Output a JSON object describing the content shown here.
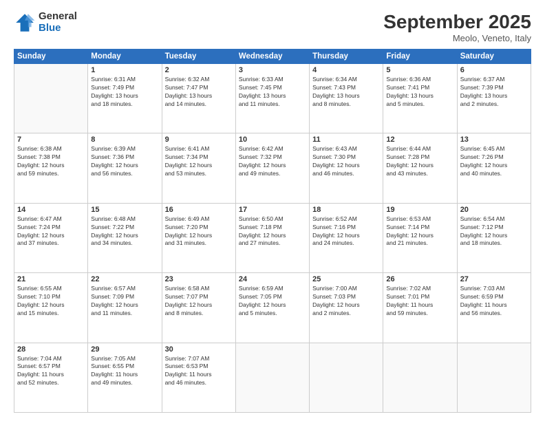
{
  "logo": {
    "general": "General",
    "blue": "Blue"
  },
  "header": {
    "month": "September 2025",
    "location": "Meolo, Veneto, Italy"
  },
  "weekdays": [
    "Sunday",
    "Monday",
    "Tuesday",
    "Wednesday",
    "Thursday",
    "Friday",
    "Saturday"
  ],
  "weeks": [
    [
      {
        "day": "",
        "info": ""
      },
      {
        "day": "1",
        "info": "Sunrise: 6:31 AM\nSunset: 7:49 PM\nDaylight: 13 hours\nand 18 minutes."
      },
      {
        "day": "2",
        "info": "Sunrise: 6:32 AM\nSunset: 7:47 PM\nDaylight: 13 hours\nand 14 minutes."
      },
      {
        "day": "3",
        "info": "Sunrise: 6:33 AM\nSunset: 7:45 PM\nDaylight: 13 hours\nand 11 minutes."
      },
      {
        "day": "4",
        "info": "Sunrise: 6:34 AM\nSunset: 7:43 PM\nDaylight: 13 hours\nand 8 minutes."
      },
      {
        "day": "5",
        "info": "Sunrise: 6:36 AM\nSunset: 7:41 PM\nDaylight: 13 hours\nand 5 minutes."
      },
      {
        "day": "6",
        "info": "Sunrise: 6:37 AM\nSunset: 7:39 PM\nDaylight: 13 hours\nand 2 minutes."
      }
    ],
    [
      {
        "day": "7",
        "info": "Sunrise: 6:38 AM\nSunset: 7:38 PM\nDaylight: 12 hours\nand 59 minutes."
      },
      {
        "day": "8",
        "info": "Sunrise: 6:39 AM\nSunset: 7:36 PM\nDaylight: 12 hours\nand 56 minutes."
      },
      {
        "day": "9",
        "info": "Sunrise: 6:41 AM\nSunset: 7:34 PM\nDaylight: 12 hours\nand 53 minutes."
      },
      {
        "day": "10",
        "info": "Sunrise: 6:42 AM\nSunset: 7:32 PM\nDaylight: 12 hours\nand 49 minutes."
      },
      {
        "day": "11",
        "info": "Sunrise: 6:43 AM\nSunset: 7:30 PM\nDaylight: 12 hours\nand 46 minutes."
      },
      {
        "day": "12",
        "info": "Sunrise: 6:44 AM\nSunset: 7:28 PM\nDaylight: 12 hours\nand 43 minutes."
      },
      {
        "day": "13",
        "info": "Sunrise: 6:45 AM\nSunset: 7:26 PM\nDaylight: 12 hours\nand 40 minutes."
      }
    ],
    [
      {
        "day": "14",
        "info": "Sunrise: 6:47 AM\nSunset: 7:24 PM\nDaylight: 12 hours\nand 37 minutes."
      },
      {
        "day": "15",
        "info": "Sunrise: 6:48 AM\nSunset: 7:22 PM\nDaylight: 12 hours\nand 34 minutes."
      },
      {
        "day": "16",
        "info": "Sunrise: 6:49 AM\nSunset: 7:20 PM\nDaylight: 12 hours\nand 31 minutes."
      },
      {
        "day": "17",
        "info": "Sunrise: 6:50 AM\nSunset: 7:18 PM\nDaylight: 12 hours\nand 27 minutes."
      },
      {
        "day": "18",
        "info": "Sunrise: 6:52 AM\nSunset: 7:16 PM\nDaylight: 12 hours\nand 24 minutes."
      },
      {
        "day": "19",
        "info": "Sunrise: 6:53 AM\nSunset: 7:14 PM\nDaylight: 12 hours\nand 21 minutes."
      },
      {
        "day": "20",
        "info": "Sunrise: 6:54 AM\nSunset: 7:12 PM\nDaylight: 12 hours\nand 18 minutes."
      }
    ],
    [
      {
        "day": "21",
        "info": "Sunrise: 6:55 AM\nSunset: 7:10 PM\nDaylight: 12 hours\nand 15 minutes."
      },
      {
        "day": "22",
        "info": "Sunrise: 6:57 AM\nSunset: 7:09 PM\nDaylight: 12 hours\nand 11 minutes."
      },
      {
        "day": "23",
        "info": "Sunrise: 6:58 AM\nSunset: 7:07 PM\nDaylight: 12 hours\nand 8 minutes."
      },
      {
        "day": "24",
        "info": "Sunrise: 6:59 AM\nSunset: 7:05 PM\nDaylight: 12 hours\nand 5 minutes."
      },
      {
        "day": "25",
        "info": "Sunrise: 7:00 AM\nSunset: 7:03 PM\nDaylight: 12 hours\nand 2 minutes."
      },
      {
        "day": "26",
        "info": "Sunrise: 7:02 AM\nSunset: 7:01 PM\nDaylight: 11 hours\nand 59 minutes."
      },
      {
        "day": "27",
        "info": "Sunrise: 7:03 AM\nSunset: 6:59 PM\nDaylight: 11 hours\nand 56 minutes."
      }
    ],
    [
      {
        "day": "28",
        "info": "Sunrise: 7:04 AM\nSunset: 6:57 PM\nDaylight: 11 hours\nand 52 minutes."
      },
      {
        "day": "29",
        "info": "Sunrise: 7:05 AM\nSunset: 6:55 PM\nDaylight: 11 hours\nand 49 minutes."
      },
      {
        "day": "30",
        "info": "Sunrise: 7:07 AM\nSunset: 6:53 PM\nDaylight: 11 hours\nand 46 minutes."
      },
      {
        "day": "",
        "info": ""
      },
      {
        "day": "",
        "info": ""
      },
      {
        "day": "",
        "info": ""
      },
      {
        "day": "",
        "info": ""
      }
    ]
  ]
}
